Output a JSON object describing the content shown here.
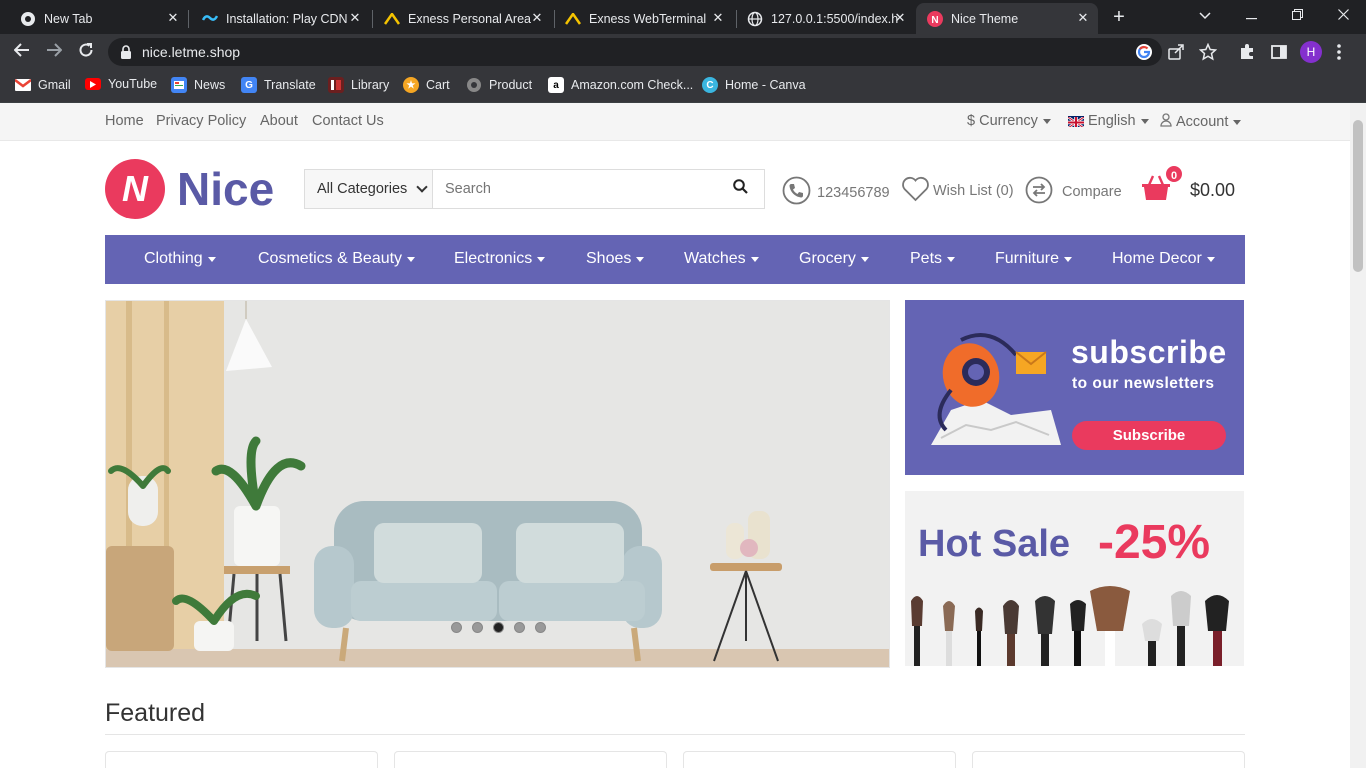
{
  "browser": {
    "tabs": [
      {
        "title": "New Tab",
        "icon": "chrome-icon"
      },
      {
        "title": "Installation: Play CDN",
        "icon": "tailwind-icon"
      },
      {
        "title": "Exness Personal Area",
        "icon": "exness-icon"
      },
      {
        "title": "Exness WebTerminal",
        "icon": "exness-icon"
      },
      {
        "title": "127.0.0.1:5500/index.h",
        "icon": "globe-icon"
      },
      {
        "title": "Nice Theme",
        "icon": "nice-icon",
        "active": true
      }
    ],
    "url": "nice.letme.shop",
    "profile_initial": "H",
    "bookmarks": [
      {
        "label": "Gmail",
        "icon": "gmail-icon"
      },
      {
        "label": "YouTube",
        "icon": "youtube-icon"
      },
      {
        "label": "News",
        "icon": "news-icon"
      },
      {
        "label": "Translate",
        "icon": "translate-icon"
      },
      {
        "label": "Library",
        "icon": "library-icon"
      },
      {
        "label": "Cart",
        "icon": "cart-bookmark-icon"
      },
      {
        "label": "Product",
        "icon": "product-icon"
      },
      {
        "label": "Amazon.com Check...",
        "icon": "amazon-icon"
      },
      {
        "label": "Home - Canva",
        "icon": "canva-icon"
      }
    ]
  },
  "site": {
    "top_links": [
      "Home",
      "Privacy Policy",
      "About",
      "Contact Us"
    ],
    "currency_label": "$ Currency",
    "language_label": "English",
    "account_label": "Account",
    "logo_letter": "N",
    "logo_name": "Nice",
    "search": {
      "category": "All Categories",
      "placeholder": "Search"
    },
    "phone": "123456789",
    "wishlist": "Wish List (0)",
    "compare": "Compare",
    "cart_count": "0",
    "cart_total": "$0.00",
    "menu": [
      "Clothing",
      "Cosmetics & Beauty",
      "Electronics",
      "Shoes",
      "Watches",
      "Grocery",
      "Pets",
      "Furniture",
      "Home Decor"
    ],
    "slider": {
      "active_index": 2,
      "count": 5
    },
    "subscribe": {
      "title": "subscribe",
      "subtitle": "to our newsletters",
      "button": "Subscribe"
    },
    "hot_sale": {
      "title": "Hot Sale",
      "discount": "-25%"
    },
    "featured_heading": "Featured",
    "colors": {
      "brand": "#6464b4",
      "accent": "#ea3a5e",
      "logo_text": "#5a5aa6"
    }
  }
}
